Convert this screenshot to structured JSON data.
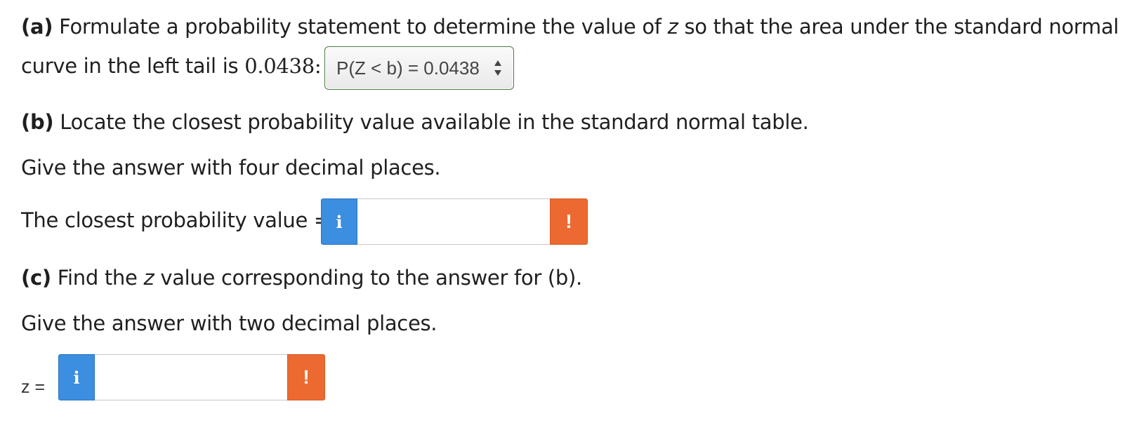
{
  "part_a": {
    "label": "(a)",
    "text_line1": " Formulate a probability statement to determine the value of ",
    "var_z": "z",
    "text_line1_end": " so that the area under the standard normal",
    "text_line2": "curve in the left tail is ",
    "value": "0.0438",
    "colon": ":",
    "select_value": "P(Z < b) = 0.0438"
  },
  "part_b": {
    "label": "(b)",
    "text": " Locate the closest probability value available in the standard normal table.",
    "instruction": "Give the answer with four decimal places.",
    "prompt": "The closest probability value =",
    "info_symbol": "i",
    "warn_symbol": "!",
    "input_value": ""
  },
  "part_c": {
    "label": "(c)",
    "text_before": " Find the ",
    "var_z": "z",
    "text_after": " value corresponding to the answer for (b).",
    "instruction": "Give the answer with two decimal places.",
    "prompt": "z =",
    "info_symbol": "i",
    "warn_symbol": "!",
    "input_value": ""
  },
  "colors": {
    "info": "#3b8ee0",
    "warning": "#ec6a31",
    "select_border": "#4a7a3c"
  }
}
